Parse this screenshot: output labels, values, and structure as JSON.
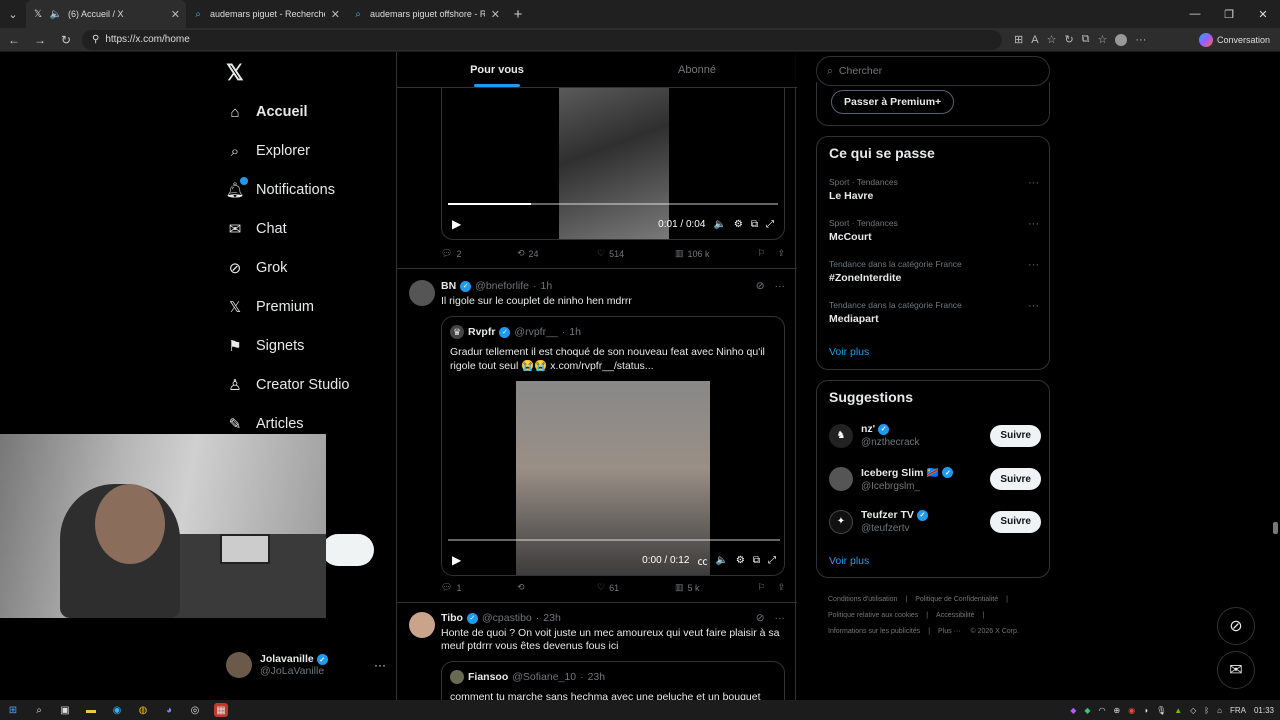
{
  "browser": {
    "tabs": [
      {
        "title": "(6) Accueil / X",
        "active": true,
        "favicon": "x-icon"
      },
      {
        "title": "audemars piguet - Recherche",
        "active": false,
        "favicon": "search-icon"
      },
      {
        "title": "audemars piguet offshore - Recher",
        "active": false,
        "favicon": "search-icon"
      }
    ],
    "url": "https://x.com/home",
    "conversation_label": "Conversation"
  },
  "sidebar": {
    "items": [
      {
        "label": "Accueil",
        "icon": "home-icon"
      },
      {
        "label": "Explorer",
        "icon": "search-icon"
      },
      {
        "label": "Notifications",
        "icon": "bell-icon"
      },
      {
        "label": "Chat",
        "icon": "mail-icon"
      },
      {
        "label": "Grok",
        "icon": "grok-icon"
      },
      {
        "label": "Premium",
        "icon": "x-icon"
      },
      {
        "label": "Signets",
        "icon": "bookmark-icon"
      },
      {
        "label": "Creator Studio",
        "icon": "creator-icon"
      },
      {
        "label": "Articles",
        "icon": "article-icon"
      }
    ],
    "profile": {
      "name": "Jolavanille",
      "handle": "@JoLaVanille"
    }
  },
  "feed": {
    "tabs": [
      "Pour vous",
      "Abonné"
    ],
    "video1": {
      "time": "0:01 / 0:04",
      "progress": 0.25
    },
    "post1_actions": {
      "replies": "2",
      "reposts": "24",
      "likes": "514",
      "views": "106 k"
    },
    "post2": {
      "name": "BN",
      "handle": "@bneforlife",
      "time": "1h",
      "text": "Il rigole sur le couplet de ninho hen mdrrr",
      "quote": {
        "name": "Rvpfr",
        "handle": "@rvpfr__",
        "time": "1h",
        "text": "Gradur tellement il est choqué de son nouveau feat avec Ninho qu'il rigole tout seul 😭😭 x.com/rvpfr__/status..."
      },
      "video_time": "0:00 / 0:12",
      "actions": {
        "replies": "1",
        "reposts": "",
        "likes": "61",
        "views": "5 k"
      }
    },
    "post3": {
      "name": "Tibo",
      "handle": "@cpastibo",
      "time": "23h",
      "text": "Honte de quoi ? On voit juste un mec amoureux qui veut faire plaisir à sa meuf ptdrrr vous êtes devenus fous ici",
      "quote": {
        "name": "Fiansoo",
        "handle": "@Sofiane_10",
        "time": "23h",
        "text": "comment tu marche sans hechma avec une peluche et un bouquet y'a"
      }
    }
  },
  "right": {
    "search_placeholder": "Chercher",
    "premium_button": "Passer à Premium+",
    "trending": {
      "title": "Ce qui se passe",
      "items": [
        {
          "context": "Sport · Tendances",
          "title": "Le Havre"
        },
        {
          "context": "Sport · Tendances",
          "title": "McCourt"
        },
        {
          "context": "Tendance dans la catégorie France",
          "title": "#ZoneInterdite"
        },
        {
          "context": "Tendance dans la catégorie France",
          "title": "Mediapart"
        }
      ],
      "more": "Voir plus"
    },
    "suggestions": {
      "title": "Suggestions",
      "items": [
        {
          "name": "nz'",
          "handle": "@nzthecrack",
          "button": "Suivre"
        },
        {
          "name": "Iceberg Slim 🇨🇩",
          "handle": "@Icebrgslm_",
          "button": "Suivre"
        },
        {
          "name": "Teufzer TV",
          "handle": "@teufzertv",
          "button": "Suivre"
        }
      ],
      "more": "Voir plus"
    },
    "footer": [
      "Conditions d'utilisation",
      "Politique de Confidentialité",
      "Politique relative aux cookies",
      "Accessibilité",
      "Informations sur les publicités",
      "Plus ···",
      "© 2026 X Corp."
    ]
  },
  "taskbar": {
    "lang": "FRA",
    "time": "01:33"
  }
}
